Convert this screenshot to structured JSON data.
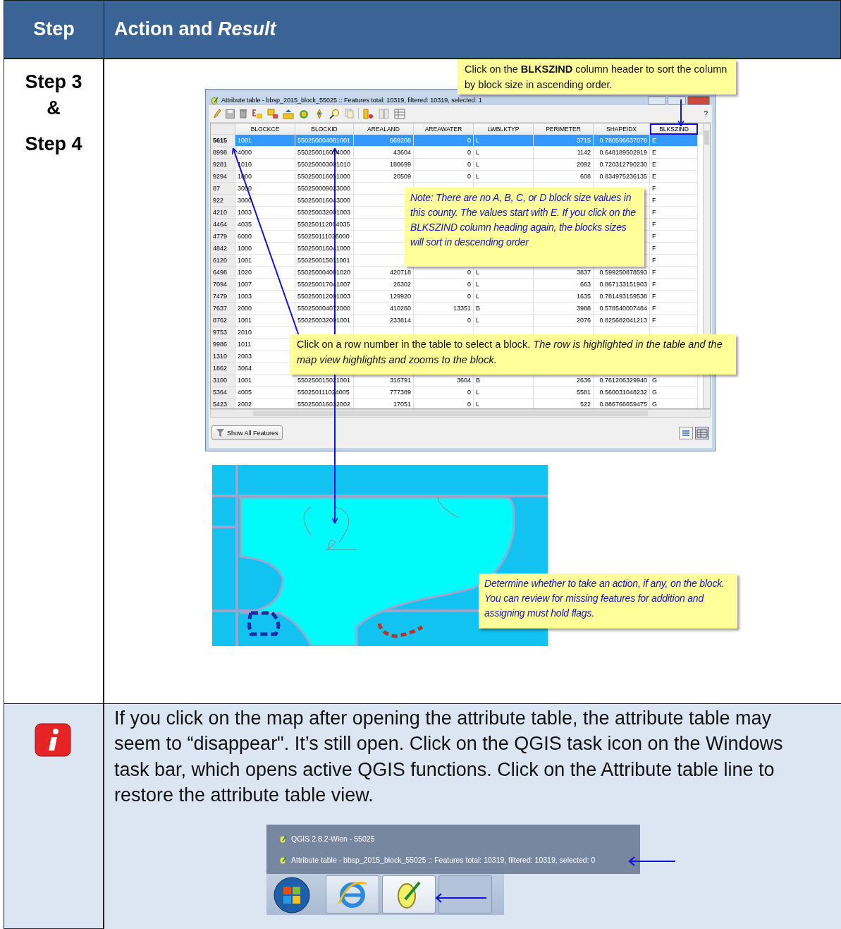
{
  "header": {
    "step": "Step",
    "action": "Action and *Result*"
  },
  "steps_row": {
    "step_lines": [
      "Step 3",
      "&",
      "Step 4"
    ],
    "attribute_window": {
      "title": "Attribute table - bbsp_2015_block_55025 :: Features total: 10319, filtered: 10319, selected: 1",
      "help": "?",
      "columns": [
        {
          "label": "BLOCKCE",
          "highlighted": false
        },
        {
          "label": "BLOCKID",
          "highlighted": false
        },
        {
          "label": "AREALAND",
          "highlighted": false
        },
        {
          "label": "AREAWATER",
          "highlighted": false
        },
        {
          "label": "LWBLKTYP",
          "highlighted": false
        },
        {
          "label": "PERIMETER",
          "highlighted": false
        },
        {
          "label": "SHAPEIDX",
          "highlighted": false
        },
        {
          "label": "BLKSZIND",
          "highlighted": true
        }
      ],
      "rows": [
        {
          "row": "5615",
          "selected": true,
          "cells": [
            "1001",
            "550250004081001",
            "669208",
            "0",
            "L",
            "3715",
            "0.780596637078",
            "E"
          ]
        },
        {
          "row": "8998",
          "selected": false,
          "cells": [
            "4000",
            "550250016014000",
            "43604",
            "0",
            "L",
            "1142",
            "0.648189502919",
            "E"
          ]
        },
        {
          "row": "9281",
          "selected": false,
          "cells": [
            "1010",
            "550250003001010",
            "180699",
            "0",
            "L",
            "2092",
            "0.720312790230",
            "E"
          ]
        },
        {
          "row": "9294",
          "selected": false,
          "cells": [
            "1000",
            "550250016051000",
            "20509",
            "0",
            "L",
            "608",
            "0.834975236135",
            "E"
          ]
        },
        {
          "row": "87",
          "selected": false,
          "cells": [
            "3000",
            "550250009023000",
            null,
            null,
            null,
            null,
            null,
            "F"
          ]
        },
        {
          "row": "922",
          "selected": false,
          "cells": [
            "3000",
            "550250016043000",
            null,
            null,
            null,
            null,
            null,
            "F"
          ]
        },
        {
          "row": "4210",
          "selected": false,
          "cells": [
            "1003",
            "550250032001003",
            null,
            null,
            null,
            null,
            null,
            "F"
          ]
        },
        {
          "row": "4464",
          "selected": false,
          "cells": [
            "4035",
            "550250112004035",
            null,
            null,
            null,
            null,
            null,
            "F"
          ]
        },
        {
          "row": "4779",
          "selected": false,
          "cells": [
            "6000",
            "550250111026000",
            null,
            null,
            null,
            null,
            null,
            "F"
          ]
        },
        {
          "row": "4842",
          "selected": false,
          "cells": [
            "1000",
            "550250016041000",
            null,
            null,
            null,
            null,
            null,
            "F"
          ]
        },
        {
          "row": "6120",
          "selected": false,
          "cells": [
            "1001",
            "550250015011001",
            null,
            null,
            null,
            null,
            null,
            "F"
          ]
        },
        {
          "row": "6498",
          "selected": false,
          "cells": [
            "1020",
            "550250004081020",
            "420718",
            "0",
            "L",
            "3837",
            "0.599250878593",
            "F"
          ]
        },
        {
          "row": "7094",
          "selected": false,
          "cells": [
            "1007",
            "550250017041007",
            "26302",
            "0",
            "L",
            "663",
            "0.867133151903",
            "F"
          ]
        },
        {
          "row": "7479",
          "selected": false,
          "cells": [
            "1003",
            "550250012001003",
            "129920",
            "0",
            "L",
            "1635",
            "0.781493159538",
            "F"
          ]
        },
        {
          "row": "7637",
          "selected": false,
          "cells": [
            "2000",
            "550250004072000",
            "410260",
            "13351",
            "B",
            "3988",
            "0.578540007484",
            "F"
          ]
        },
        {
          "row": "8762",
          "selected": false,
          "cells": [
            "1001",
            "550250032001001",
            "233814",
            "0",
            "L",
            "2076",
            "0.825682041213",
            "F"
          ]
        },
        {
          "row": "9753",
          "selected": false,
          "cells": [
            "2010",
            null,
            null,
            null,
            null,
            null,
            null,
            null
          ]
        },
        {
          "row": "9986",
          "selected": false,
          "cells": [
            "1011",
            null,
            null,
            null,
            null,
            null,
            null,
            null
          ]
        },
        {
          "row": "1310",
          "selected": false,
          "cells": [
            "2003",
            null,
            null,
            null,
            null,
            null,
            null,
            null
          ]
        },
        {
          "row": "1862",
          "selected": false,
          "cells": [
            "3064",
            null,
            null,
            null,
            null,
            null,
            null,
            null
          ]
        },
        {
          "row": "3100",
          "selected": false,
          "cells": [
            "1001",
            "550250015021001",
            "316791",
            "3604",
            "B",
            "2636",
            "0.761206329940",
            "G"
          ]
        },
        {
          "row": "5364",
          "selected": false,
          "cells": [
            "4005",
            "550250111024005",
            "777389",
            "0",
            "L",
            "5581",
            "0.560031048232",
            "G"
          ]
        },
        {
          "row": "5423",
          "selected": false,
          "cells": [
            "2002",
            "550250016032002",
            "17051",
            "0",
            "L",
            "522",
            "0.886766659475",
            "G"
          ]
        }
      ],
      "show_all_button": "Show All Features"
    },
    "callouts": [
      {
        "kind": "instruction",
        "text": "Click on the **BLKSZIND** column header to sort the column by block size in ascending order."
      },
      {
        "kind": "note",
        "text": "Note: There are no A, B, C, or D block size values in this county. The values start with E. If you click on the BLKSZIND column heading again, the blocks sizes will sort in descending order"
      },
      {
        "kind": "instruction",
        "text": "Click on a row number in the table to select a block. *The row is highlighted in the table and the map view highlights and zooms to the block.*"
      },
      {
        "kind": "note",
        "text": "Determine whether to take an action, if any, on the block. You can review for missing features for addition and assigning must hold flags."
      }
    ]
  },
  "info_row": {
    "text": "If you click on the map after opening the attribute table, the attribute table may seem to “disappear\". It’s still open. Click on the QGIS task icon on the Windows task bar, which opens active QGIS functions. Click on the Attribute table line to restore the attribute table view.",
    "jump_items": [
      "QGIS 2.8.2-Wien - 55025",
      "Attribute table - bbsp_2015_block_55025 :: Features total: 10319, filtered: 10319, selected: 0"
    ]
  }
}
